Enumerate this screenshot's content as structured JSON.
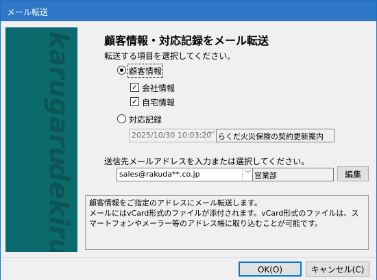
{
  "window": {
    "title": "メール転送"
  },
  "banner": {
    "word_top": "karugaru",
    "word_bottom": "dekiru"
  },
  "main": {
    "heading": "顧客情報・対応記録をメール転送",
    "instruction": "転送する項目を選択してください。",
    "option_customer": {
      "label": "顧客情報",
      "selected": true
    },
    "option_company": {
      "label": "会社情報",
      "checked": true
    },
    "option_home": {
      "label": "自宅情報",
      "checked": true
    },
    "option_record": {
      "label": "対応記録",
      "selected": false
    },
    "record_select": {
      "datetime": "2025/10/30 10:03:20",
      "subject": "らくだ火災保険の契約更新案内"
    },
    "address_prompt": "送信先メールアドレスを入力または選択してください。",
    "address_value": "sales@rakuda**.co.jp",
    "address_dept": "営業部",
    "edit_button": "編集",
    "info_lines": [
      "顧客情報をご指定のアドレスにメール転送します。",
      "メールにはvCard形式のファイルが添付されます。vCard形式のファイルは、ス",
      "マートフォンやメーラー等のアドレス帳に取り込むことが可能です。"
    ]
  },
  "footer": {
    "ok_label": "OK(O)",
    "cancel_label": "キャンセル(C)"
  },
  "icons": {
    "dropdown": "chevron-down-icon",
    "check": "checkmark-icon"
  }
}
